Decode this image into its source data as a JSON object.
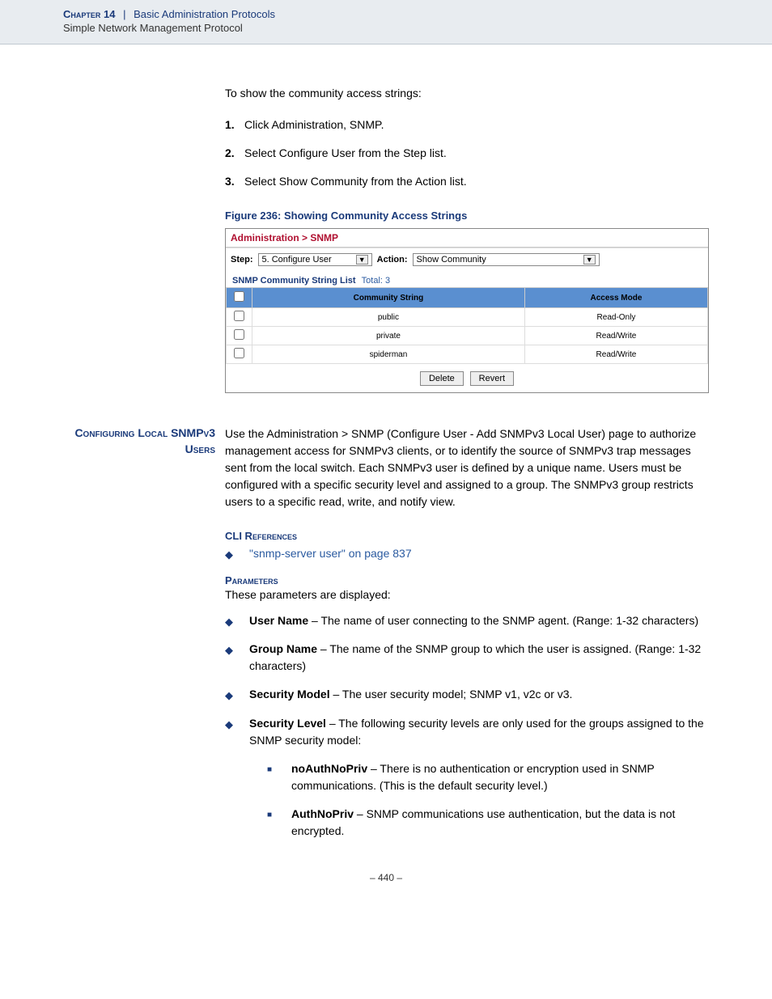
{
  "header": {
    "chapter": "Chapter 14",
    "separator": "|",
    "section": "Basic Administration Protocols",
    "subsection": "Simple Network Management Protocol"
  },
  "intro": "To show the community access strings:",
  "steps": [
    {
      "num": "1.",
      "text": "Click Administration, SNMP."
    },
    {
      "num": "2.",
      "text": "Select Configure User from the Step list."
    },
    {
      "num": "3.",
      "text": "Select Show Community from the Action list."
    }
  ],
  "figure": {
    "caption": "Figure 236:  Showing Community Access Strings"
  },
  "screenshot": {
    "breadcrumb": "Administration > SNMP",
    "step_label": "Step:",
    "step_value": "5. Configure User",
    "action_label": "Action:",
    "action_value": "Show Community",
    "list_title": "SNMP Community String List",
    "total_label": "Total:",
    "total_value": "3",
    "columns": {
      "check": "",
      "cs": "Community String",
      "am": "Access Mode"
    },
    "rows": [
      {
        "cs": "public",
        "am": "Read-Only"
      },
      {
        "cs": "private",
        "am": "Read/Write"
      },
      {
        "cs": "spiderman",
        "am": "Read/Write"
      }
    ],
    "buttons": {
      "delete": "Delete",
      "revert": "Revert"
    }
  },
  "config_section": {
    "heading": "Configuring Local SNMPv3 Users",
    "body": "Use the Administration > SNMP (Configure User - Add SNMPv3 Local User) page to authorize management access for SNMPv3 clients, or to identify the source of SNMPv3 trap messages sent from the local switch. Each SNMPv3 user is defined by a unique name. Users must be configured with a specific security level and assigned to a group. The SNMPv3 group restricts users to a specific read, write, and notify view."
  },
  "cli": {
    "heading": "CLI References",
    "link": "\"snmp-server user\" on page 837"
  },
  "params": {
    "heading": "Parameters",
    "intro": "These parameters are displayed:",
    "items": [
      {
        "name": "User Name",
        "desc": " – The name of user connecting to the SNMP agent. (Range: 1-32 characters)"
      },
      {
        "name": "Group Name",
        "desc": " – The name of the SNMP group to which the user is assigned. (Range: 1-32 characters)"
      },
      {
        "name": "Security Model",
        "desc": " – The user security model; SNMP v1, v2c or v3."
      },
      {
        "name": "Security Level",
        "desc": " – The following security levels are only used for the groups assigned to the SNMP security model:"
      }
    ],
    "sublevels": [
      {
        "name": "noAuthNoPriv",
        "desc": " – There is no authentication or encryption used in SNMP communications. (This is the default security level.)"
      },
      {
        "name": "AuthNoPriv",
        "desc": " – SNMP communications use authentication, but the data is not encrypted."
      }
    ]
  },
  "page_number": "–  440  –"
}
